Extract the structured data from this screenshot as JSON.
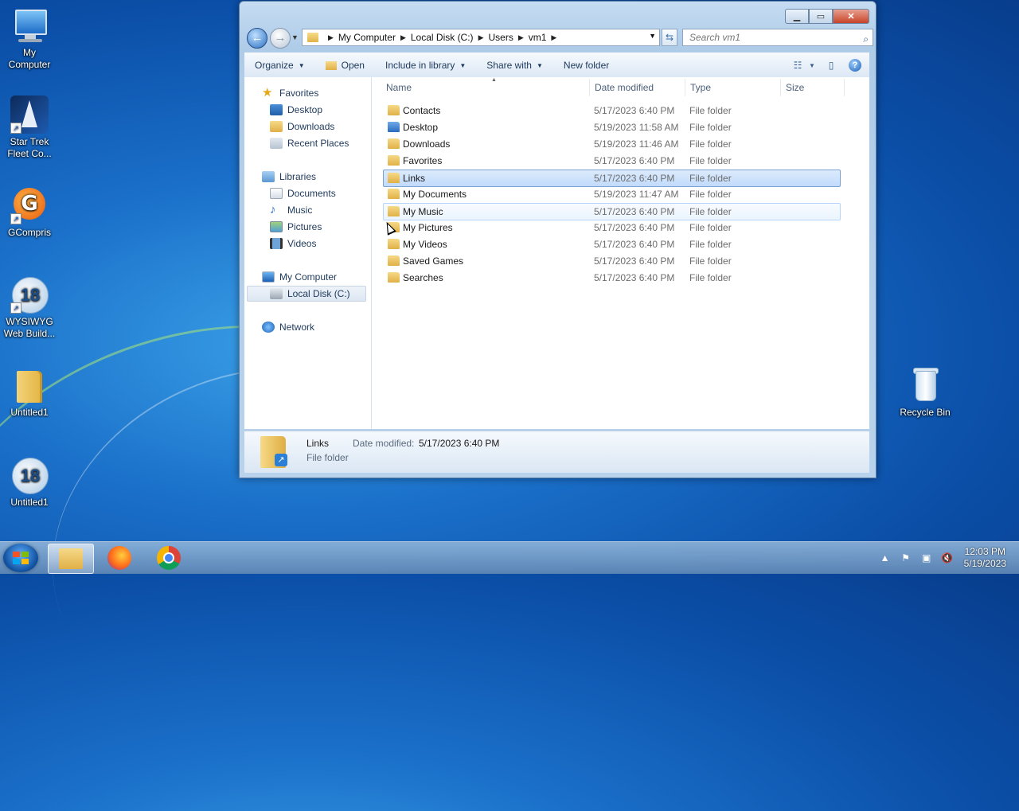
{
  "desktop": {
    "icons": [
      {
        "label": "My Computer"
      },
      {
        "label": "Star Trek Fleet Co..."
      },
      {
        "label": "GCompris"
      },
      {
        "label": "WYSIWYG Web Build..."
      },
      {
        "label": "Untitled1"
      },
      {
        "label": "Untitled1"
      },
      {
        "label": "Recycle Bin"
      }
    ]
  },
  "window": {
    "address": {
      "crumbs": [
        "My Computer",
        "Local Disk (C:)",
        "Users",
        "vm1"
      ]
    },
    "search": {
      "placeholder": "Search vm1"
    },
    "toolbar": {
      "organize": "Organize",
      "open": "Open",
      "include_in_library": "Include in library",
      "share_with": "Share with",
      "new_folder": "New folder"
    },
    "nav": {
      "favorites": "Favorites",
      "desktop": "Desktop",
      "downloads": "Downloads",
      "recent_places": "Recent Places",
      "libraries": "Libraries",
      "documents": "Documents",
      "music": "Music",
      "pictures": "Pictures",
      "videos": "Videos",
      "my_computer": "My Computer",
      "local_disk": "Local Disk (C:)",
      "network": "Network"
    },
    "columns": {
      "name": "Name",
      "date_modified": "Date modified",
      "type": "Type",
      "size": "Size"
    },
    "files": [
      {
        "name": "Contacts",
        "date": "5/17/2023 6:40 PM",
        "type": "File folder"
      },
      {
        "name": "Desktop",
        "date": "5/19/2023 11:58 AM",
        "type": "File folder"
      },
      {
        "name": "Downloads",
        "date": "5/19/2023 11:46 AM",
        "type": "File folder"
      },
      {
        "name": "Favorites",
        "date": "5/17/2023 6:40 PM",
        "type": "File folder"
      },
      {
        "name": "Links",
        "date": "5/17/2023 6:40 PM",
        "type": "File folder"
      },
      {
        "name": "My Documents",
        "date": "5/19/2023 11:47 AM",
        "type": "File folder"
      },
      {
        "name": "My Music",
        "date": "5/17/2023 6:40 PM",
        "type": "File folder"
      },
      {
        "name": "My Pictures",
        "date": "5/17/2023 6:40 PM",
        "type": "File folder"
      },
      {
        "name": "My Videos",
        "date": "5/17/2023 6:40 PM",
        "type": "File folder"
      },
      {
        "name": "Saved Games",
        "date": "5/17/2023 6:40 PM",
        "type": "File folder"
      },
      {
        "name": "Searches",
        "date": "5/17/2023 6:40 PM",
        "type": "File folder"
      }
    ],
    "details": {
      "name": "Links",
      "type": "File folder",
      "date_label": "Date modified:",
      "date_value": "5/17/2023 6:40 PM"
    }
  },
  "taskbar": {
    "clock_time": "12:03 PM",
    "clock_date": "5/19/2023"
  }
}
